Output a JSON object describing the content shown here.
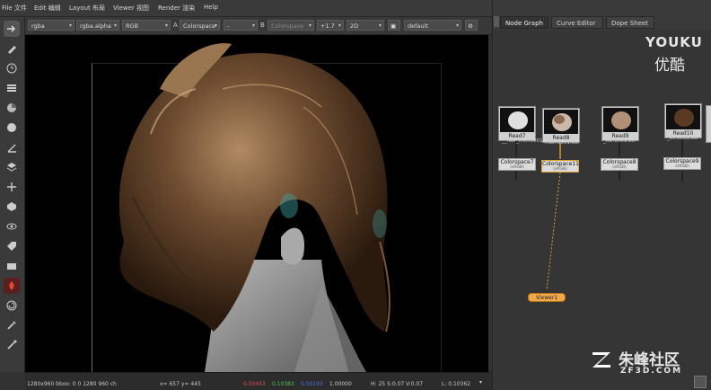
{
  "menubar": {
    "items": [
      "File 文件",
      "Edit 编辑",
      "Layout 布局",
      "Viewer 视图",
      "Render 渲染",
      "Help"
    ]
  },
  "toolbar": {
    "channels": "rgba",
    "alpha": "rgba.alpha",
    "display": "RGB",
    "label_a": "A",
    "input_a": "Colorspace",
    "dash": "-",
    "label_b": "B",
    "input_b": "Colorspace",
    "gain": "+1.7",
    "mode": "2D",
    "lut": "default"
  },
  "left_tools": [
    "input-arrow-icon",
    "pencil-icon",
    "clock-icon",
    "list-icon",
    "pie-icon",
    "circle-icon",
    "angle-icon",
    "layers-icon",
    "move-icon",
    "hexagon-icon",
    "eye-icon",
    "tag-icon",
    "box-icon",
    "flame-icon",
    "spiral-icon",
    "brush-icon",
    "wand-icon"
  ],
  "statusbar": {
    "resolution": "1280x960 bbox: 0 0 1280 960 ch",
    "coords": "x= 657 y= 445",
    "r": "0.50453",
    "g": "0.10383",
    "b": "0.50193",
    "a": "1.00000",
    "hsv": "H: 25 S:0.07 V:0.07",
    "luma": "L: 0.10362",
    "colors": {
      "r": "#e05050",
      "g": "#50c050",
      "b": "#5070e0"
    }
  },
  "right_panel": {
    "tabs": [
      "Node Graph",
      "Curve Editor",
      "Dope Sheet"
    ],
    "active_tab": "Node Graph"
  },
  "nodes": {
    "reads": [
      {
        "label": "Read7",
        "file": "__hair_mth.0001"
      },
      {
        "label": "Read8",
        "file": "nder.0001.exr"
      },
      {
        "label": "Read9",
        "file": "_ise.0001.exr"
      },
      {
        "label": "Read10",
        "file": "_sh.0001.exr"
      }
    ],
    "colorspaces": [
      {
        "label": "Colorspace7",
        "sub": "(sRGB)"
      },
      {
        "label": "Colorspace11",
        "sub": "(sRGB)"
      },
      {
        "label": "Colorspace8",
        "sub": "(sRGB)"
      },
      {
        "label": "Colorspace9",
        "sub": "(sRGB)"
      }
    ],
    "viewer": "Viewer1",
    "colors": {
      "read": "#d0d0d0",
      "colorspace": "#dcdcdc",
      "viewer": "#f0a94a"
    }
  },
  "watermarks": {
    "youku_en": "YOUKU",
    "youku_cn": "优酷",
    "site_cn": "朱峰社区",
    "site_url": "ZF3D.COM"
  }
}
